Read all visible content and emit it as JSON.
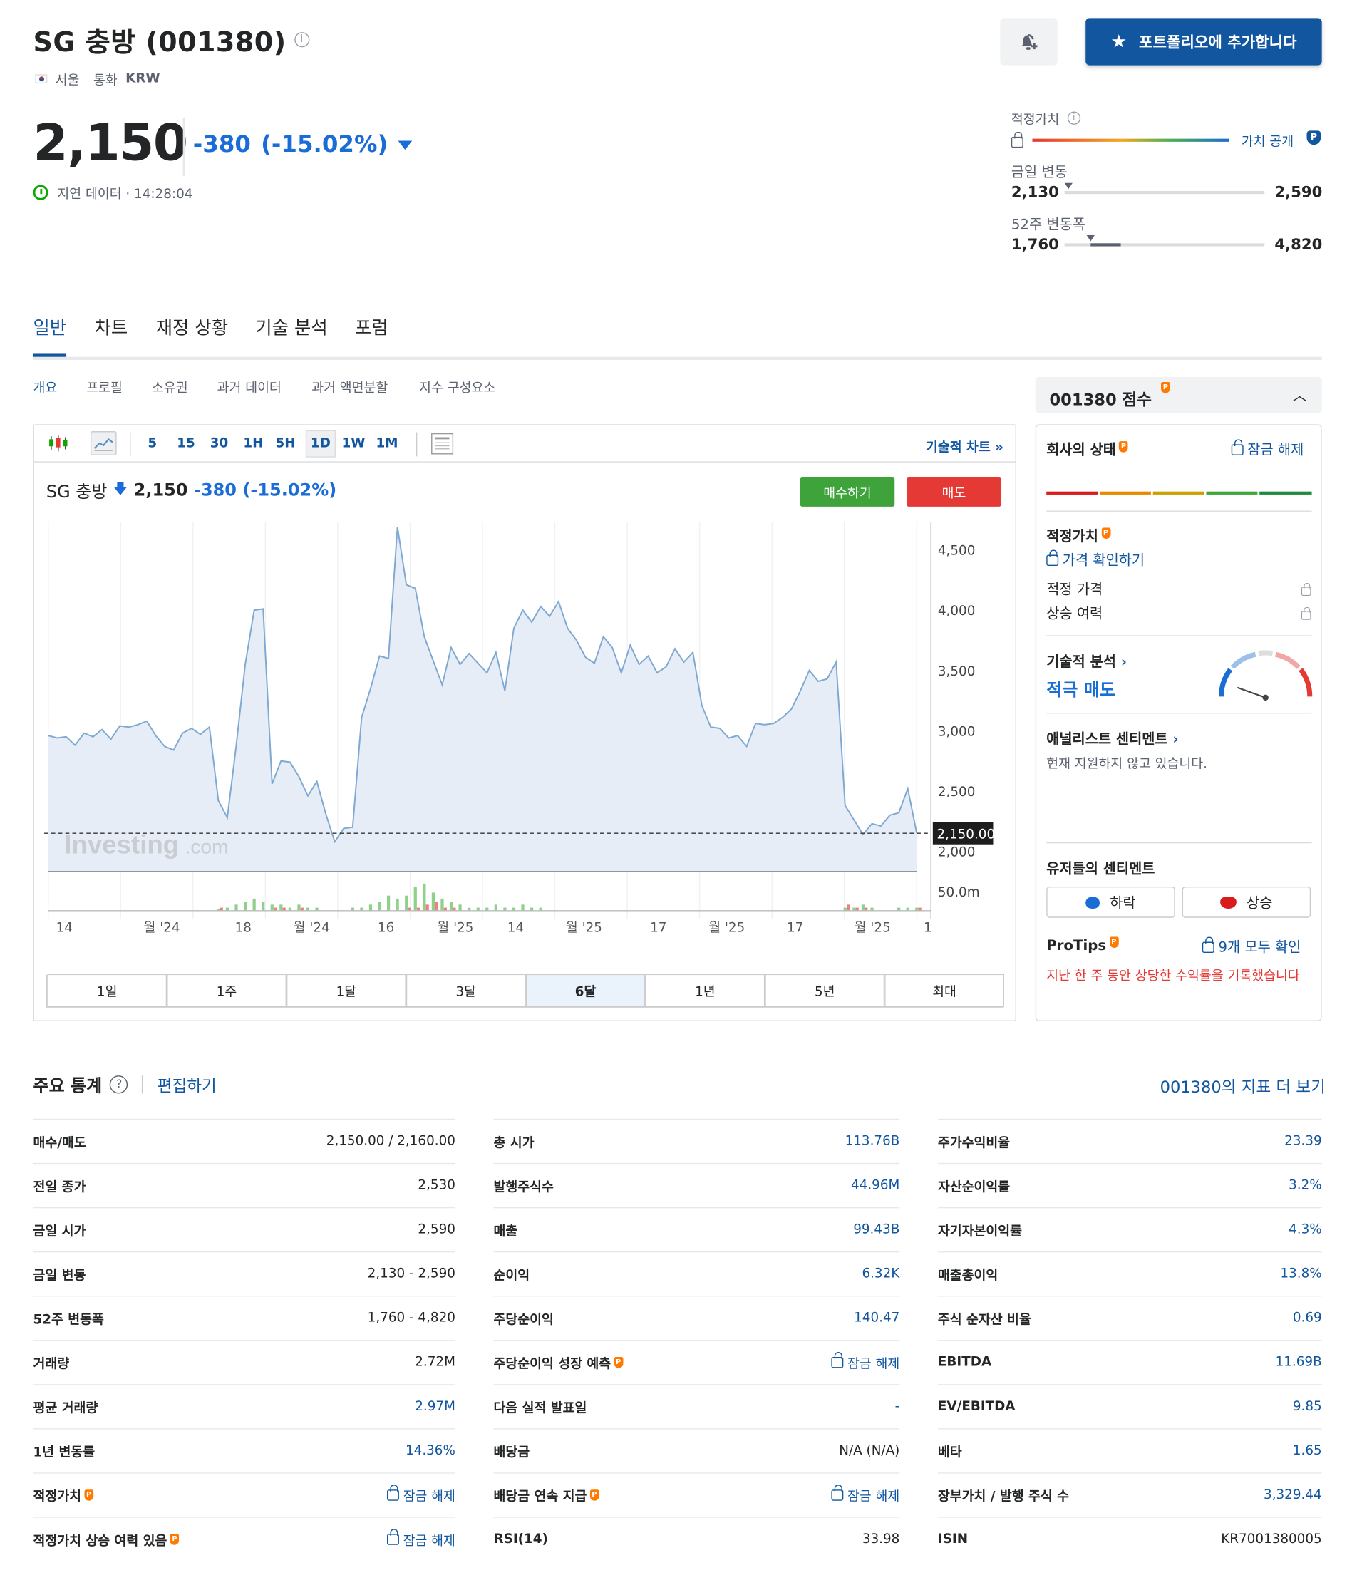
{
  "header": {
    "title": "SG 충방 (001380)",
    "exchange": "서울",
    "currency_label": "통화",
    "currency": "KRW",
    "price": "2,150",
    "change": "-380",
    "change_pct": "(-15.02%)",
    "delay_text": "지연 데이터 · 14:28:04",
    "portfolio_btn": "포트폴리오에 추가합니다"
  },
  "ranges": {
    "fair_label": "적정가치",
    "fair_link": "가치 공개",
    "day_label": "금일 변동",
    "day_low": "2,130",
    "day_high": "2,590",
    "year_label": "52주 변동폭",
    "year_low": "1,760",
    "year_high": "4,820",
    "day_pos": 0.0,
    "year_pos": 0.13
  },
  "tabs": [
    "일반",
    "차트",
    "재정 상황",
    "기술 분석",
    "포럼"
  ],
  "subtabs": [
    "개요",
    "프로필",
    "소유권",
    "과거 데이터",
    "과거 액면분할",
    "지수 구성요소"
  ],
  "chart_toolbar": {
    "intervals": [
      "5",
      "15",
      "30",
      "1H",
      "5H",
      "1D",
      "1W",
      "1M"
    ],
    "tech_chart": "기술적 차트 »"
  },
  "chart_header": {
    "name": "SG 충방",
    "price": "2,150",
    "change": "-380",
    "change_pct": "(-15.02%)",
    "buy": "매수하기",
    "sell": "매도"
  },
  "periods": [
    "1일",
    "1주",
    "1달",
    "3달",
    "6달",
    "1년",
    "5년",
    "최대"
  ],
  "chart_data": {
    "type": "area",
    "y_ticks": [
      "4,500",
      "4,000",
      "3,500",
      "3,000",
      "2,500",
      "2,000"
    ],
    "vol_tick": "50.0m",
    "last_label": "2,150.00",
    "x_labels": [
      "14",
      "월 '24",
      "18",
      "월 '24",
      "16",
      "월 '25",
      "14",
      "월 '25",
      "17",
      "월 '25",
      "17",
      "월 '25",
      "1"
    ],
    "watermark": "Investing",
    "watermark2": ".com",
    "ylim": [
      1900,
      4800
    ],
    "values": [
      2960,
      2940,
      2950,
      2880,
      2980,
      2950,
      3010,
      2930,
      3040,
      3030,
      3050,
      3080,
      2960,
      2870,
      2840,
      2980,
      3020,
      2970,
      3030,
      2420,
      2280,
      2880,
      3550,
      4000,
      4010,
      2560,
      2750,
      2740,
      2620,
      2460,
      2580,
      2310,
      2080,
      2190,
      2200,
      3110,
      3350,
      3620,
      3600,
      4690,
      4210,
      4180,
      3780,
      3580,
      3380,
      3690,
      3550,
      3640,
      3560,
      3480,
      3650,
      3330,
      3850,
      4000,
      3900,
      4030,
      3950,
      4070,
      3850,
      3750,
      3610,
      3560,
      3780,
      3690,
      3480,
      3710,
      3550,
      3620,
      3480,
      3530,
      3680,
      3570,
      3650,
      3210,
      3030,
      3020,
      2940,
      2960,
      2870,
      3060,
      3050,
      3060,
      3110,
      3180,
      3330,
      3500,
      3410,
      3430,
      3570,
      2380,
      2260,
      2140,
      2230,
      2210,
      2300,
      2320,
      2520,
      2150
    ],
    "volume": [
      0,
      0,
      0,
      0,
      0,
      0,
      0,
      0,
      0,
      0,
      0,
      0,
      0,
      0,
      0,
      0,
      0,
      0,
      0,
      0.5,
      1,
      2,
      3,
      4,
      3,
      2,
      2,
      1,
      2,
      1,
      1,
      0,
      0,
      0,
      1,
      1,
      2,
      3,
      5,
      4,
      5,
      8,
      9,
      6,
      4,
      3,
      2,
      1,
      1,
      1,
      2,
      1,
      1,
      2,
      1,
      1,
      0,
      0,
      0,
      0,
      0,
      0,
      0,
      0,
      0,
      0,
      0,
      0,
      0,
      0,
      0,
      0,
      0,
      0,
      0,
      0,
      0,
      0,
      0,
      0,
      0,
      0,
      0,
      0,
      0,
      0,
      0,
      0,
      0,
      1,
      1,
      2,
      1,
      0,
      0,
      1,
      1,
      1
    ],
    "volume_down": [
      0,
      0,
      0,
      0,
      0,
      0,
      0,
      0,
      0,
      0,
      0,
      0,
      0,
      0,
      0,
      0,
      0,
      0,
      0,
      1,
      0,
      0,
      0,
      0,
      0,
      1,
      1,
      0,
      1,
      0,
      0,
      0,
      0,
      0,
      0,
      0,
      0,
      0,
      0,
      0,
      1,
      1,
      2,
      3,
      1,
      1,
      0,
      0,
      0,
      0,
      0,
      0,
      0,
      0,
      0,
      0,
      0,
      0,
      0,
      0,
      0,
      0,
      0,
      0,
      0,
      0,
      0,
      0,
      0,
      0,
      0,
      0,
      0,
      0,
      0,
      0,
      0,
      0,
      0,
      0,
      0,
      0,
      0,
      0,
      0,
      0,
      0,
      0,
      0,
      2,
      1,
      1,
      0,
      0,
      0,
      0,
      0,
      1
    ]
  },
  "side": {
    "score_title": "001380 점수",
    "health": "회사의 상태",
    "unlock": "잠금 해제",
    "fair": "적정가치",
    "check_price": "가격 확인하기",
    "fair_price": "적정 가격",
    "upside": "상승 여력",
    "tech": "기술적 분석",
    "tech_val": "적극 매도",
    "analyst": "애널리스트 센티멘트",
    "analyst_note": "현재 지원하지 않고 있습니다.",
    "user_sent": "유저들의 센티멘트",
    "bear": "하락",
    "bull": "상승",
    "protips": "ProTips",
    "all_tips": "9개 모두 확인",
    "tip_text": "지난 한 주 동안 상당한 수익률을 기록했습니다"
  },
  "stats": {
    "title": "주요 통계",
    "edit": "편집하기",
    "more": "001380의 지표 더 보기",
    "unlock": "잠금 해제",
    "col1": [
      [
        "매수/매도",
        "2,150.00  /  2,160.00",
        0,
        0
      ],
      [
        "전일 종가",
        "2,530",
        0,
        0
      ],
      [
        "금일 시가",
        "2,590",
        0,
        0
      ],
      [
        "금일 변동",
        "2,130 - 2,590",
        0,
        0
      ],
      [
        "52주 변동폭",
        "1,760 - 4,820",
        0,
        0
      ],
      [
        "거래량",
        "2.72M",
        0,
        0
      ],
      [
        "평균 거래량",
        "2.97M",
        1,
        0
      ],
      [
        "1년 변동률",
        "14.36%",
        1,
        0
      ],
      [
        "적정가치",
        "잠금 해제",
        1,
        1
      ],
      [
        "적정가치 상승 여력 있음",
        "잠금 해제",
        1,
        1
      ]
    ],
    "col2": [
      [
        "총 시가",
        "113.76B",
        1,
        0
      ],
      [
        "발행주식수",
        "44.96M",
        1,
        0
      ],
      [
        "매출",
        "99.43B",
        1,
        0
      ],
      [
        "순이익",
        "6.32K",
        1,
        0
      ],
      [
        "주당순이익",
        "140.47",
        1,
        0
      ],
      [
        "주당순이익 성장 예측",
        "잠금 해제",
        1,
        1
      ],
      [
        "다음 실적 발표일",
        "-",
        1,
        0
      ],
      [
        "배당금",
        "N/A (N/A)",
        0,
        0
      ],
      [
        "배당금 연속 지급",
        "잠금 해제",
        1,
        1
      ],
      [
        "RSI(14)",
        "33.98",
        0,
        0
      ]
    ],
    "col3": [
      [
        "주가수익비율",
        "23.39",
        1,
        0
      ],
      [
        "자산순이익률",
        "3.2%",
        1,
        0
      ],
      [
        "자기자본이익률",
        "4.3%",
        1,
        0
      ],
      [
        "매출총이익",
        "13.8%",
        1,
        0
      ],
      [
        "주식 순자산 비율",
        "0.69",
        1,
        0
      ],
      [
        "EBITDA",
        "11.69B",
        1,
        0
      ],
      [
        "EV/EBITDA",
        "9.85",
        1,
        0
      ],
      [
        "베타",
        "1.65",
        1,
        0
      ],
      [
        "장부가치 / 발행 주식 수",
        "3,329.44",
        1,
        0
      ],
      [
        "ISIN",
        "KR7001380005",
        0,
        0
      ]
    ]
  }
}
